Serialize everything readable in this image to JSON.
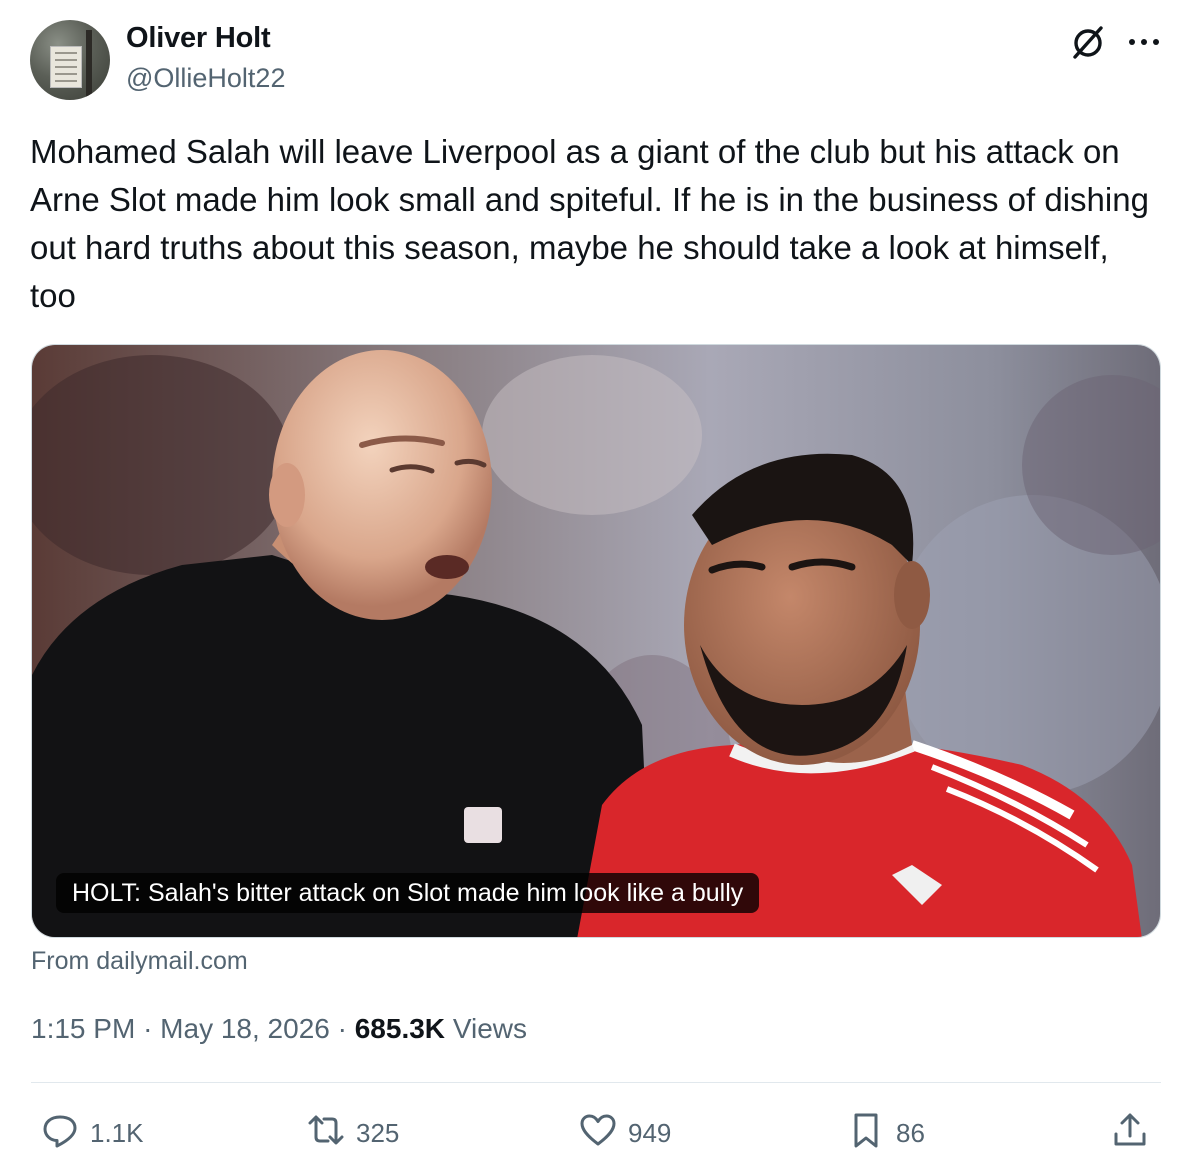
{
  "author": {
    "name": "Oliver Holt",
    "handle": "@OllieHolt22"
  },
  "icons": {
    "grok": "grok-icon",
    "more": "more-icon",
    "reply": "reply-icon",
    "retweet": "retweet-icon",
    "like": "heart-icon",
    "bookmark": "bookmark-icon",
    "share": "share-icon"
  },
  "tweet": {
    "text": "Mohamed Salah will leave Liverpool as a giant of the club but his attack on Arne Slot made him look small and spiteful. If he is in the business of dishing out hard truths about this season, maybe he should take a look at himself, too"
  },
  "card": {
    "caption": "HOLT: Salah's bitter attack on Slot made him look like a bully",
    "source": "From dailymail.com"
  },
  "meta": {
    "time": "1:15 PM",
    "separator": "·",
    "date": "May 18, 2026",
    "views_count": "685.3K",
    "views_label": "Views"
  },
  "actions": {
    "replies": "1.1K",
    "reposts": "325",
    "likes": "949",
    "bookmarks": "86"
  },
  "colors": {
    "text": "#0f1419",
    "secondary": "#536471",
    "divider": "#e1e8ed",
    "kit_red": "#d9262b"
  }
}
